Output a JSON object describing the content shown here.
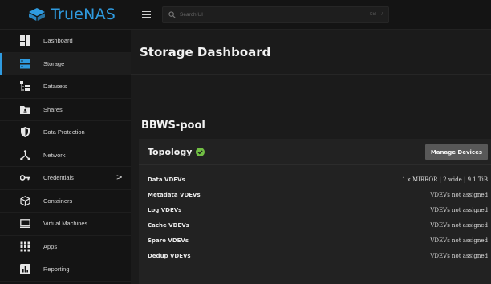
{
  "app": {
    "name": "TrueNAS"
  },
  "colors": {
    "accent": "#2f9be0",
    "success": "#71bf44"
  },
  "search": {
    "placeholder": "Search UI",
    "shortcut": "Ctrl + /"
  },
  "sidebar": {
    "items": [
      {
        "label": "Dashboard",
        "icon": "dashboard-icon"
      },
      {
        "label": "Storage",
        "icon": "storage-icon",
        "active": true
      },
      {
        "label": "Datasets",
        "icon": "datasets-icon"
      },
      {
        "label": "Shares",
        "icon": "shares-icon"
      },
      {
        "label": "Data Protection",
        "icon": "shield-icon"
      },
      {
        "label": "Network",
        "icon": "network-icon"
      },
      {
        "label": "Credentials",
        "icon": "key-icon",
        "has_submenu": true
      },
      {
        "label": "Containers",
        "icon": "containers-icon"
      },
      {
        "label": "Virtual Machines",
        "icon": "monitor-icon"
      },
      {
        "label": "Apps",
        "icon": "apps-grid-icon"
      },
      {
        "label": "Reporting",
        "icon": "reporting-icon"
      }
    ],
    "chevron": ">"
  },
  "page": {
    "title": "Storage Dashboard"
  },
  "pool": {
    "name": "BBWS-pool",
    "topology": {
      "title": "Topology",
      "status_icon": "check-circle-icon",
      "manage_label": "Manage Devices",
      "rows": [
        {
          "label": "Data VDEVs",
          "value": "1 x MIRROR | 2 wide | 9.1 TiB"
        },
        {
          "label": "Metadata VDEVs",
          "value": "VDEVs not assigned"
        },
        {
          "label": "Log VDEVs",
          "value": "VDEVs not assigned"
        },
        {
          "label": "Cache VDEVs",
          "value": "VDEVs not assigned"
        },
        {
          "label": "Spare VDEVs",
          "value": "VDEVs not assigned"
        },
        {
          "label": "Dedup VDEVs",
          "value": "VDEVs not assigned"
        }
      ]
    }
  }
}
